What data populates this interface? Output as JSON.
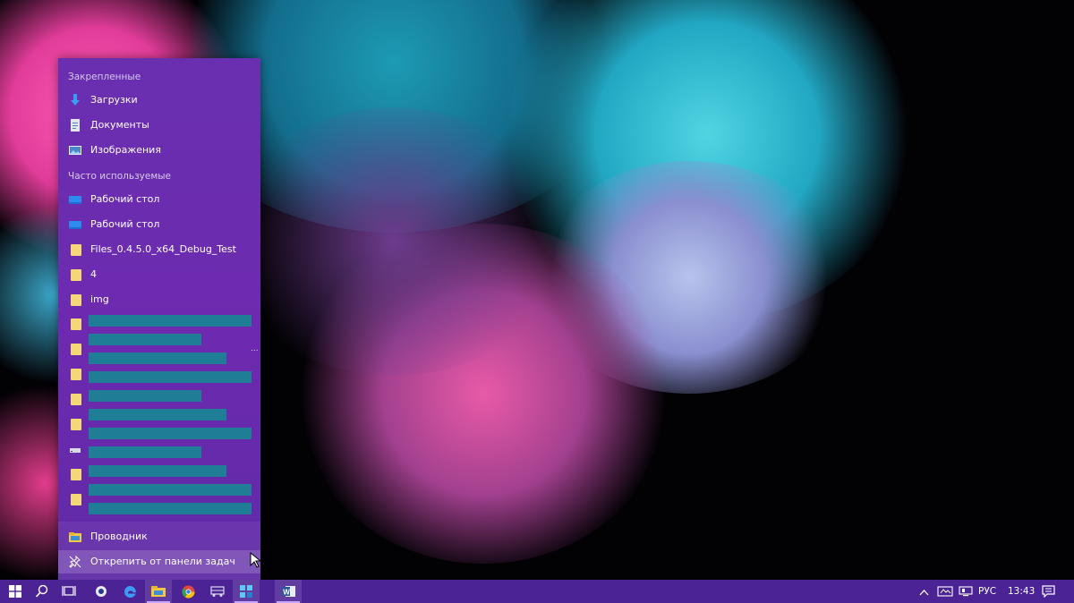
{
  "jumplist": {
    "pinned_title": "Закрепленные",
    "pinned": [
      {
        "label": "Загрузки",
        "icon": "download-arrow-icon"
      },
      {
        "label": "Документы",
        "icon": "document-icon"
      },
      {
        "label": "Изображения",
        "icon": "pictures-icon"
      }
    ],
    "frequent_title": "Часто используемые",
    "frequent": [
      {
        "label": "Рабочий стол",
        "icon": "desktop-icon"
      },
      {
        "label": "Рабочий стол",
        "icon": "desktop-icon"
      },
      {
        "label": "Files_0.4.5.0_x64_Debug_Test",
        "icon": "folder-icon"
      },
      {
        "label": "4",
        "icon": "folder-icon"
      },
      {
        "label": "img",
        "icon": "folder-icon"
      }
    ],
    "overflow_indicator": "...",
    "app_label": "Проводник",
    "unpin_label": "Открепить от панели задач"
  },
  "taskbar": {
    "tray": {
      "language": "РУС",
      "time": "13:43"
    }
  },
  "colors": {
    "jumplist_bg": "#6a2fb0",
    "taskbar_bg": "#4c2394",
    "redaction": "#1f7d96",
    "folder": "#f5d777"
  }
}
